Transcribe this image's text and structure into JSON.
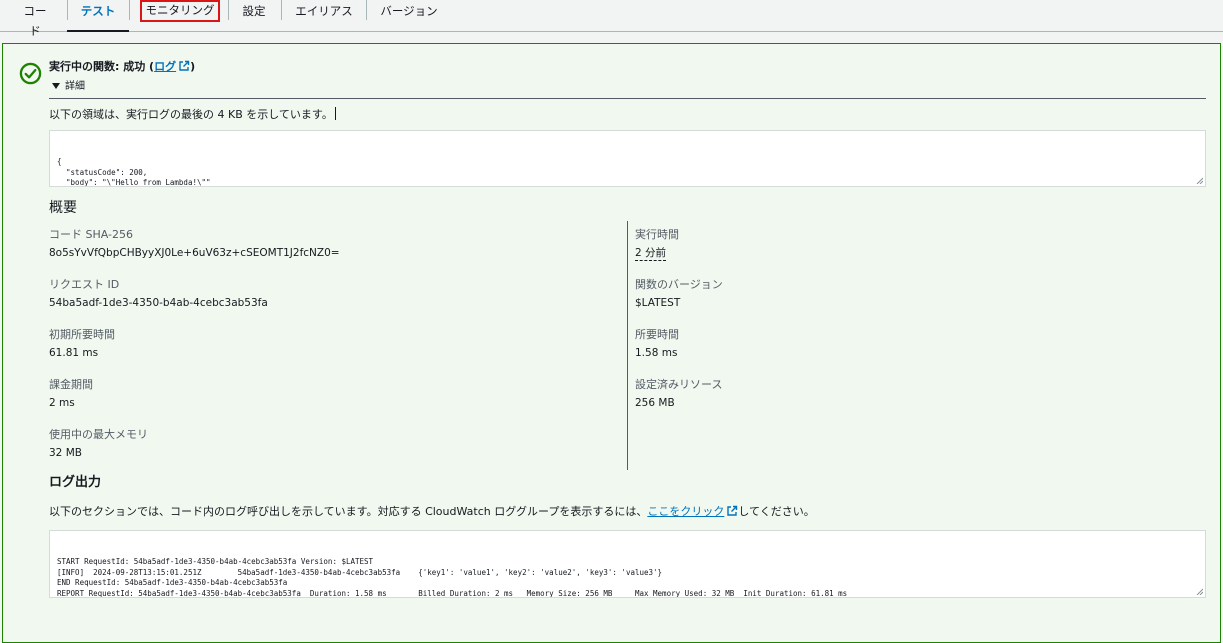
{
  "tabs": [
    {
      "label": "コード"
    },
    {
      "label": "テスト"
    },
    {
      "label": "モニタリング"
    },
    {
      "label": "設定"
    },
    {
      "label": "エイリアス"
    },
    {
      "label": "バージョン"
    }
  ],
  "result": {
    "title_prefix": "実行中の関数: 成功 (",
    "log_link": "ログ",
    "title_suffix": ")",
    "details_label": "詳細",
    "intro": "以下の領域は、実行ログの最後の 4 KB を示しています。",
    "output_json": "{\n  \"statusCode\": 200,\n  \"body\": \"\\\"Hello from Lambda!\\\"\"\n}",
    "status_color": "#1d8102"
  },
  "summary": {
    "heading": "概要",
    "left": [
      {
        "label": "コード SHA-256",
        "value": "8o5sYvVfQbpCHByyXJ0Le+6uV63z+cSEOMT1J2fcNZ0="
      },
      {
        "label": "リクエスト ID",
        "value": "54ba5adf-1de3-4350-b4ab-4cebc3ab53fa"
      },
      {
        "label": "初期所要時間",
        "value": "61.81 ms"
      },
      {
        "label": "課金期間",
        "value": "2 ms"
      },
      {
        "label": "使用中の最大メモリ",
        "value": "32 MB"
      }
    ],
    "right": [
      {
        "label": "実行時間",
        "value": "2 分前"
      },
      {
        "label": "関数のバージョン",
        "value": "$LATEST"
      },
      {
        "label": "所要時間",
        "value": "1.58 ms"
      },
      {
        "label": "設定済みリソース",
        "value": "256 MB"
      }
    ]
  },
  "log_output": {
    "heading": "ログ出力",
    "desc_prefix": "以下のセクションでは、コード内のログ呼び出しを示しています。対応する CloudWatch ロググループを表示するには、",
    "desc_link": "ここをクリック",
    "desc_suffix": "してください。",
    "lines": "START RequestId: 54ba5adf-1de3-4350-b4ab-4cebc3ab53fa Version: $LATEST\n[INFO]  2024-09-28T13:15:01.251Z        54ba5adf-1de3-4350-b4ab-4cebc3ab53fa    {'key1': 'value1', 'key2': 'value2', 'key3': 'value3'}\nEND RequestId: 54ba5adf-1de3-4350-b4ab-4cebc3ab53fa\nREPORT RequestId: 54ba5adf-1de3-4350-b4ab-4cebc3ab53fa  Duration: 1.58 ms       Billed Duration: 2 ms   Memory Size: 256 MB     Max Memory Used: 32 MB  Init Duration: 61.81 ms"
  }
}
